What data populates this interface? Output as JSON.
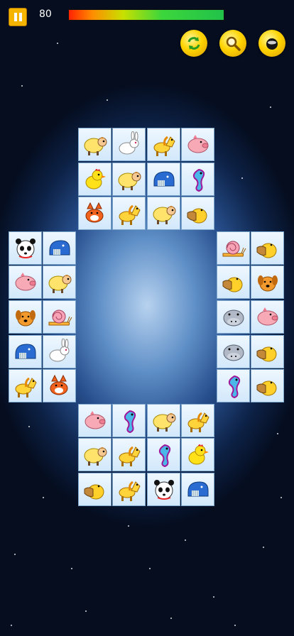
{
  "hud": {
    "score": "80",
    "time_remaining_fraction": 1.0,
    "controls": [
      {
        "name": "shuffle-button",
        "icon": "refresh-icon"
      },
      {
        "name": "hint-button",
        "icon": "magnifier-icon"
      },
      {
        "name": "bomb-button",
        "icon": "bomb-icon"
      }
    ]
  },
  "colors": {
    "tile_bg": "#e4f1fd",
    "tile_border": "#7fa8cf",
    "button_gold": "#ffd400",
    "pause_orange": "#f5b400"
  },
  "board": {
    "rows": [
      {
        "cells": [
          null,
          null,
          "sheep",
          "rabbit",
          "pony",
          "pig",
          null,
          null
        ]
      },
      {
        "cells": [
          null,
          null,
          "chick",
          "sheep",
          "whale",
          "seahorse",
          null,
          null
        ]
      },
      {
        "cells": [
          null,
          null,
          "fox",
          "pony",
          "sheep",
          "pelican",
          null,
          null
        ]
      },
      {
        "cells": [
          "panda",
          "whale",
          null,
          null,
          null,
          null,
          "snail",
          "pelican"
        ]
      },
      {
        "cells": [
          "pig",
          "sheep",
          null,
          null,
          null,
          null,
          "pelican",
          "dog"
        ]
      },
      {
        "cells": [
          "dog",
          "snail",
          null,
          null,
          null,
          null,
          "hippo",
          "pig"
        ]
      },
      {
        "cells": [
          "whale",
          "rabbit",
          null,
          null,
          null,
          null,
          "hippo",
          "pelican"
        ]
      },
      {
        "cells": [
          "pony",
          "fox",
          null,
          null,
          null,
          null,
          "seahorse",
          "pelican"
        ]
      },
      {
        "cells": [
          null,
          null,
          "pig",
          "seahorse",
          "sheep",
          "pony",
          null,
          null
        ]
      },
      {
        "cells": [
          null,
          null,
          "sheep",
          "pony",
          "seahorse",
          "chick",
          null,
          null
        ]
      },
      {
        "cells": [
          null,
          null,
          "pelican",
          "pony",
          "panda",
          "whale",
          null,
          null
        ]
      }
    ]
  }
}
